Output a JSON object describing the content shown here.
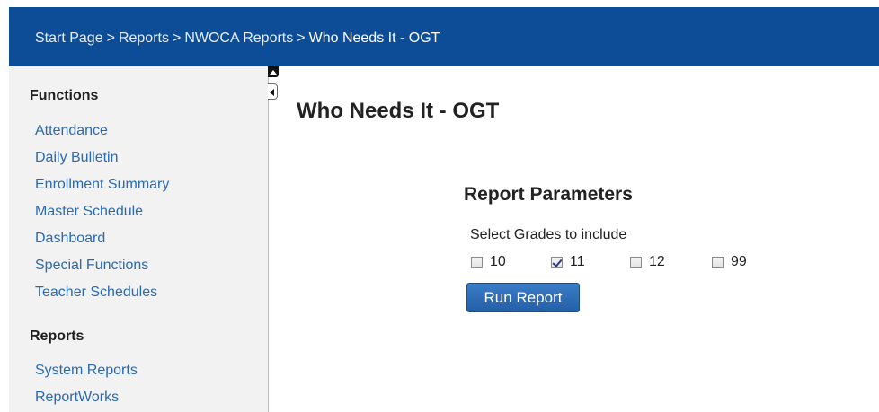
{
  "breadcrumb": {
    "items": [
      "Start Page",
      "Reports",
      "NWOCA Reports",
      "Who Needs It - OGT"
    ],
    "separator": ">"
  },
  "sidebar": {
    "sections": [
      {
        "title": "Functions",
        "items": [
          "Attendance",
          "Daily Bulletin",
          "Enrollment Summary",
          "Master Schedule",
          "Dashboard",
          "Special Functions",
          "Teacher Schedules"
        ]
      },
      {
        "title": "Reports",
        "items": [
          "System Reports",
          "ReportWorks"
        ]
      }
    ]
  },
  "main": {
    "title": "Who Needs It - OGT",
    "parameters": {
      "title": "Report Parameters",
      "grades_label": "Select Grades to include",
      "grades": [
        {
          "label": "10",
          "checked": false
        },
        {
          "label": "11",
          "checked": true
        },
        {
          "label": "12",
          "checked": false
        },
        {
          "label": "99",
          "checked": false
        }
      ],
      "run_button": "Run Report"
    }
  },
  "colors": {
    "header_bg": "#0d4d97",
    "link": "#2a6ab1",
    "sidebar_bg": "#f2f2f2",
    "button_bg": "#2a6ab1"
  }
}
